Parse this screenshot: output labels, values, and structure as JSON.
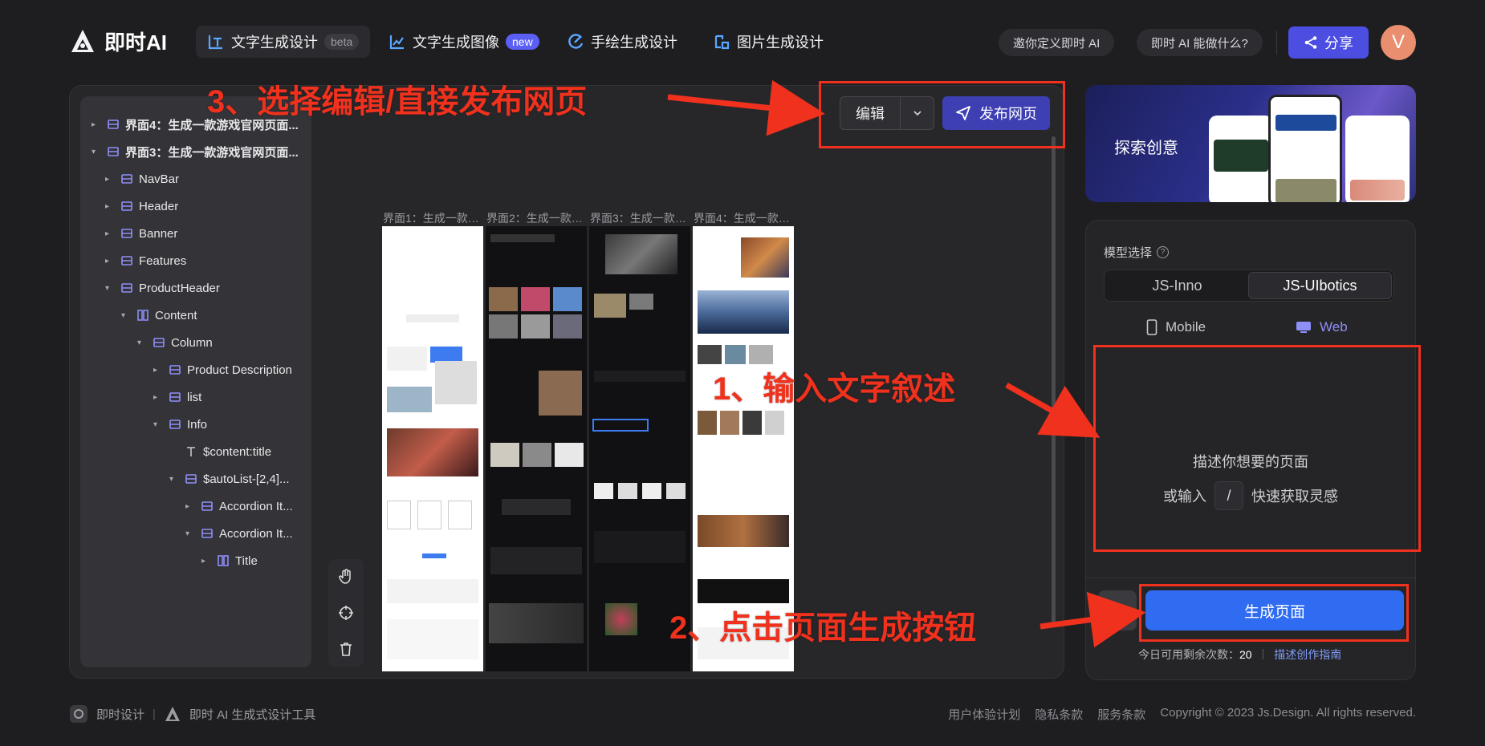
{
  "header": {
    "logo_text": "即时AI",
    "tabs": [
      {
        "label": "文字生成设计",
        "badge": "beta"
      },
      {
        "label": "文字生成图像",
        "badge": "new"
      },
      {
        "label": "手绘生成设计",
        "badge": ""
      },
      {
        "label": "图片生成设计",
        "badge": ""
      }
    ],
    "invite_label": "邀你定义即时 AI",
    "about_label": "即时 AI 能做什么?",
    "share_label": "分享",
    "avatar_letter": "V"
  },
  "layers": [
    {
      "label": "界面4：生成一款游戏官网页面...",
      "bold": true,
      "caret": "right",
      "icon": "frame-icon"
    },
    {
      "label": "界面3：生成一款游戏官网页面...",
      "bold": true,
      "caret": "down",
      "icon": "frame-icon"
    },
    {
      "label": "NavBar",
      "caret": "right",
      "icon": "frame-icon"
    },
    {
      "label": "Header",
      "caret": "right",
      "icon": "frame-icon"
    },
    {
      "label": "Banner",
      "caret": "right",
      "icon": "frame-icon"
    },
    {
      "label": "Features",
      "caret": "right",
      "icon": "frame-icon"
    },
    {
      "label": "ProductHeader",
      "caret": "down",
      "icon": "frame-icon"
    },
    {
      "label": "Content",
      "caret": "down",
      "icon": "column-icon"
    },
    {
      "label": "Column",
      "caret": "down",
      "icon": "frame-icon"
    },
    {
      "label": "Product Description",
      "caret": "right",
      "icon": "frame-icon"
    },
    {
      "label": "list",
      "caret": "right",
      "icon": "frame-icon"
    },
    {
      "label": "Info",
      "caret": "down",
      "icon": "frame-icon"
    },
    {
      "label": "$content:title",
      "caret": "",
      "icon": "text-icon"
    },
    {
      "label": "$autoList-[2,4]...",
      "caret": "down",
      "icon": "frame-icon"
    },
    {
      "label": "Accordion It...",
      "caret": "right",
      "icon": "frame-icon"
    },
    {
      "label": "Accordion It...",
      "caret": "down",
      "icon": "frame-icon"
    },
    {
      "label": "Title",
      "caret": "right",
      "icon": "column-icon"
    }
  ],
  "canvas": {
    "edit_label": "编辑",
    "publish_label": "发布网页",
    "thumbs": [
      {
        "label": "界面1：生成一款…",
        "theme": "light"
      },
      {
        "label": "界面2：生成一款…",
        "theme": "dark"
      },
      {
        "label": "界面3：生成一款…",
        "theme": "dark"
      },
      {
        "label": "界面4：生成一款…",
        "theme": "light"
      }
    ]
  },
  "right_panel": {
    "banner_title": "探索创意",
    "model_label": "模型选择",
    "models": [
      "JS-Inno",
      "JS-UIbotics"
    ],
    "selected_model": "JS-UIbotics",
    "platforms": [
      "Mobile",
      "Web"
    ],
    "selected_platform": "Web",
    "prompt_line1": "描述你想要的页面",
    "prompt_line2_pre": "或输入",
    "prompt_key": "/",
    "prompt_line2_post": "快速获取灵感",
    "generate_label": "生成页面",
    "quota_label": "今日可用剩余次数：",
    "quota_value": "20",
    "guide_link": "描述创作指南"
  },
  "annotations": {
    "step1": "1、输入文字叙述",
    "step2": "2、点击页面生成按钮",
    "step3": "3、选择编辑/直接发布网页",
    "color": "#f0311d"
  },
  "footer": {
    "brand1": "即时设计",
    "brand2": "即时 AI 生成式设计工具",
    "links": [
      "用户体验计划",
      "隐私条款",
      "服务条款"
    ],
    "copyright": "Copyright © 2023 Js.Design. All rights reserved."
  },
  "colors": {
    "accent": "#4b4ee0",
    "generate": "#2f6cf2",
    "background": "#1e1e20"
  }
}
